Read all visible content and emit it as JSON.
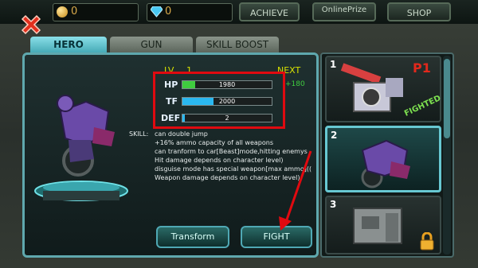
{
  "currency": {
    "gold": "0",
    "gems": "0"
  },
  "top_buttons": {
    "achieve": "ACHIEVE",
    "online_prize": "OnlinePrize",
    "shop": "SHOP"
  },
  "tabs": [
    {
      "label": "HERO",
      "active": true
    },
    {
      "label": "GUN",
      "active": false
    },
    {
      "label": "SKILL BOOST",
      "active": false
    }
  ],
  "hero": {
    "level_label": "LV.",
    "level": "1",
    "next_label": "NEXT",
    "next_gain": "+180",
    "stats": [
      {
        "label": "HP",
        "value": "1980",
        "fill": 0.14,
        "color": "#3fcc3f"
      },
      {
        "label": "TF",
        "value": "2000",
        "fill": 0.35,
        "color": "#2ab8f0"
      },
      {
        "label": "DEF",
        "value": "2",
        "fill": 0.03,
        "color": "#2ab8f0"
      }
    ],
    "skill_label": "SKILL:",
    "skills": [
      "can double jump",
      "+16% ammo capacity of all weapons",
      "can tranform to car[Beast]mode,hitting enemys",
      "Hit damage depends on character level)",
      "disguise mode has special weapon[max ammo]((",
      "Weapon damage depends on character level)"
    ]
  },
  "actions": {
    "transform": "Transform",
    "fight": "FIGHT"
  },
  "roster": [
    {
      "number": "1",
      "badge": "P1",
      "status": "FIGHTED",
      "locked": false
    },
    {
      "number": "2",
      "badge": "",
      "status": "",
      "locked": false
    },
    {
      "number": "3",
      "badge": "",
      "status": "",
      "locked": true
    }
  ],
  "colors": {
    "accent": "#5fa8ae",
    "highlight_box": "#e00a10",
    "arrow": "#e00a10"
  }
}
